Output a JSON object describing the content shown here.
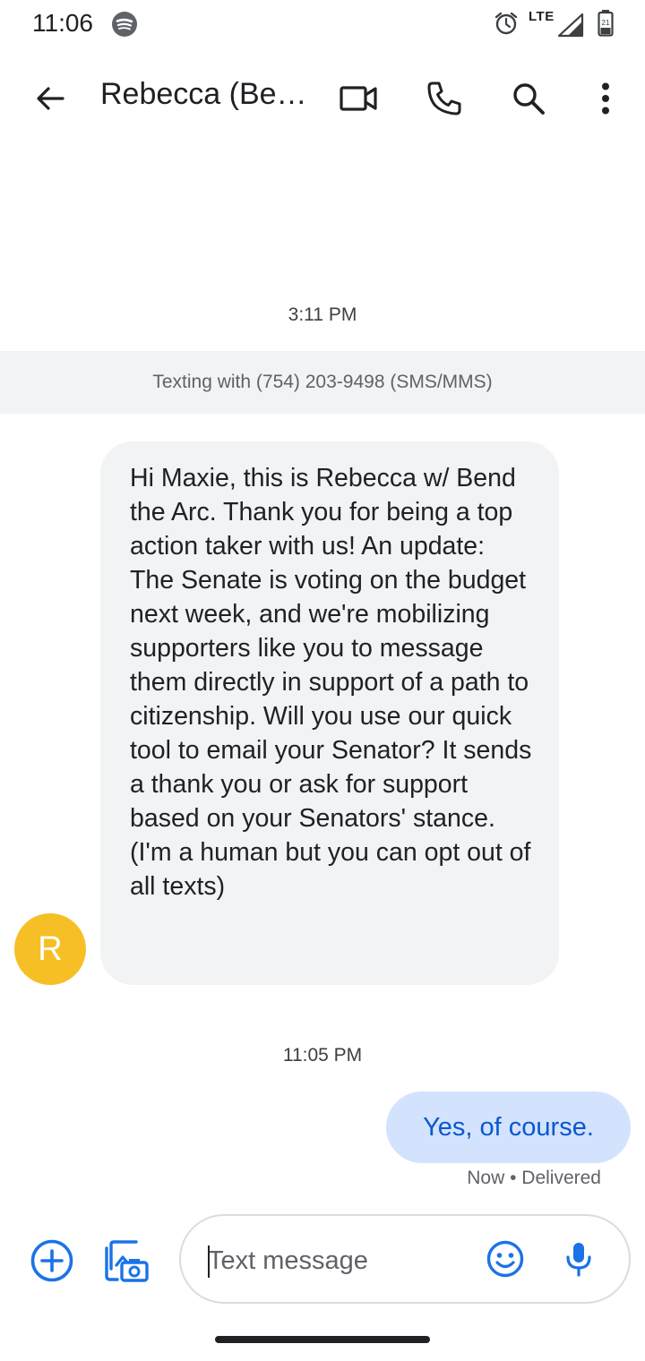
{
  "status_bar": {
    "time": "11:06",
    "network_label": "LTE",
    "battery_level": "21",
    "icons": [
      "spotify-icon",
      "alarm-icon",
      "signal-icon",
      "battery-icon"
    ]
  },
  "header": {
    "contact_name": "Rebecca (Be…",
    "actions": [
      "back-icon",
      "video-call-icon",
      "phone-icon",
      "search-icon",
      "more-vert-icon"
    ]
  },
  "conversation": {
    "timestamp_1": "3:11 PM",
    "info_text": "Texting with (754) 203-9498 (SMS/MMS)",
    "avatar_initial": "R",
    "incoming_message": "Hi Maxie, this is Rebecca w/ Bend the Arc. Thank you for being a top action taker with us! An update: The Senate is voting on the budget next week, and we're mobilizing supporters like you to message them directly in support of a path to citizenship. Will you use our quick tool to email your Senator? It sends a thank you or ask for support based on your Senators' stance. (I'm a human but you can opt out of all texts)",
    "timestamp_2": "11:05 PM",
    "outgoing_message": "Yes, of course.",
    "delivery_status": "Now • Delivered"
  },
  "composer": {
    "placeholder": "Text message",
    "value": "",
    "icons": [
      "add-icon",
      "gallery-camera-icon",
      "emoji-icon",
      "mic-icon"
    ]
  },
  "colors": {
    "accent": "#1a73e8",
    "avatar": "#f6bf26",
    "incoming_bubble": "#f1f3f4",
    "outgoing_bubble": "#d3e3fd",
    "outgoing_text": "#0b57d0"
  }
}
